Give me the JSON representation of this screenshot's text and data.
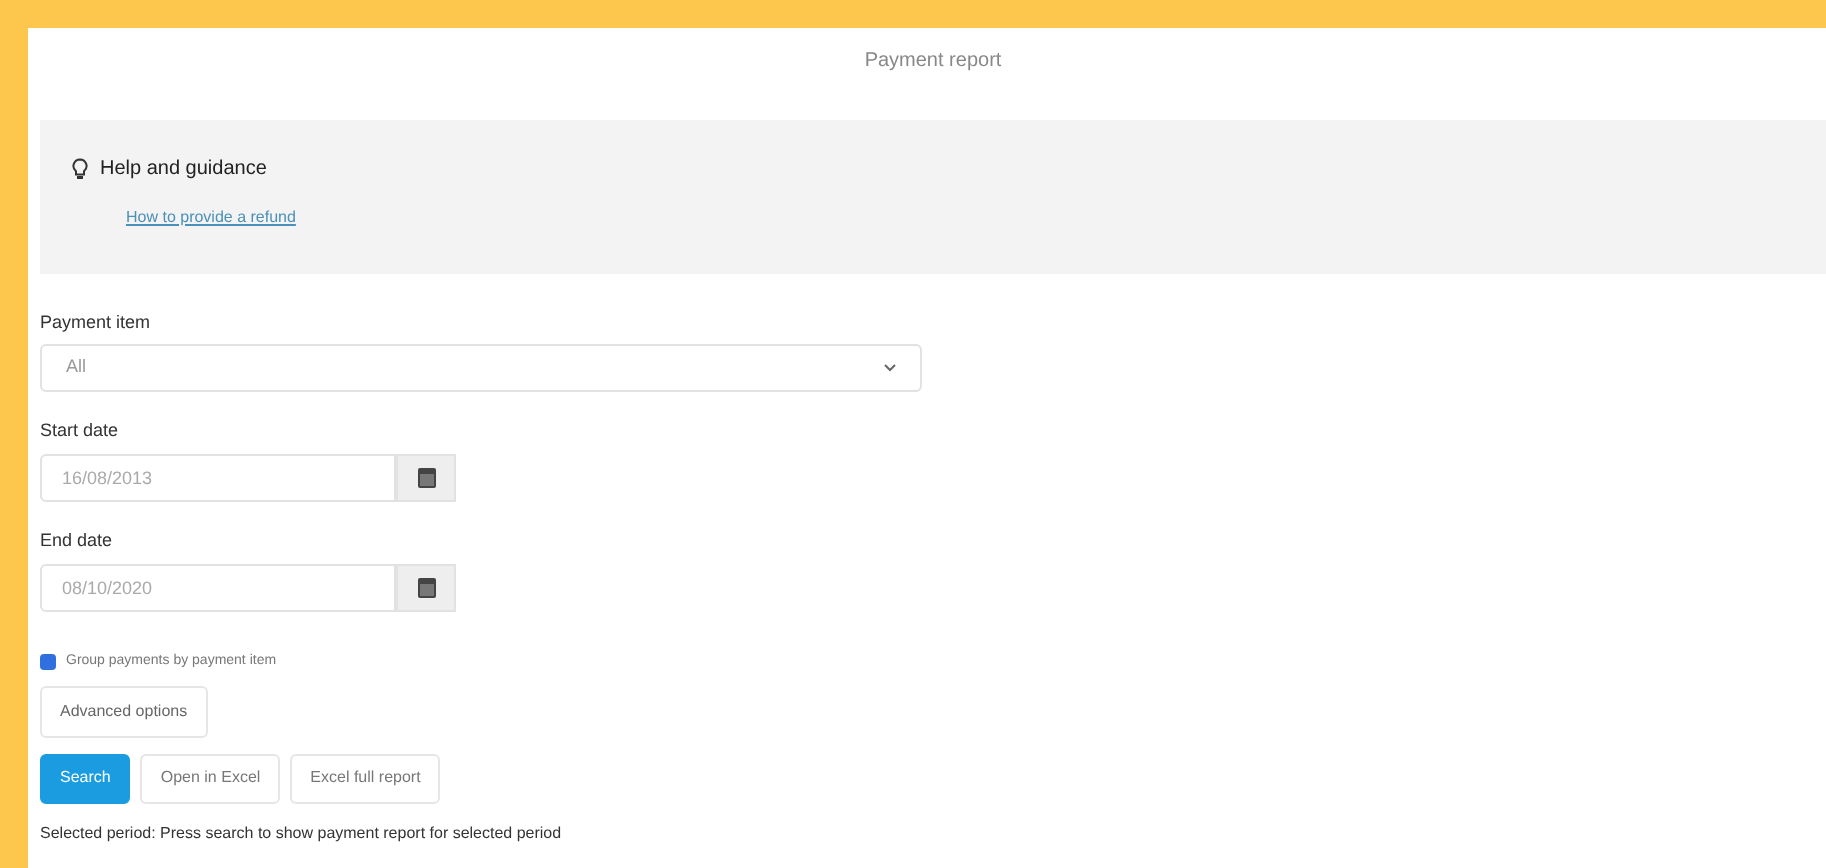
{
  "title": "Payment report",
  "help": {
    "title": "Help and guidance",
    "link": "How to provide a refund"
  },
  "payment_item": {
    "label": "Payment item",
    "value": "All"
  },
  "start_date": {
    "label": "Start date",
    "value": "16/08/2013"
  },
  "end_date": {
    "label": "End date",
    "value": "08/10/2020"
  },
  "group_checkbox": {
    "label": "Group payments by payment item",
    "checked": true
  },
  "advanced_button": "Advanced options",
  "buttons": [
    {
      "label": "Search",
      "kind": "primary"
    },
    {
      "label": "Open in Excel",
      "kind": "default"
    },
    {
      "label": "Excel full report",
      "kind": "default"
    }
  ],
  "status": "Selected period: Press search to show payment report for selected period"
}
